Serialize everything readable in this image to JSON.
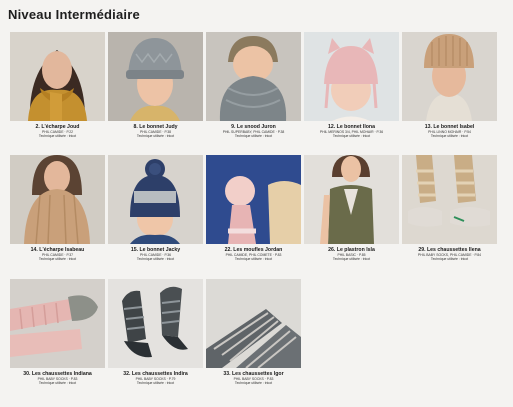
{
  "section": {
    "title": "Niveau Intermédiaire"
  },
  "items": [
    {
      "title": "2. L'écharpe Joud",
      "yarn": "PHIL CAMIDE · P.22",
      "technique": "Technique utilisée : tricot"
    },
    {
      "title": "8. Le bonnet Judy",
      "yarn": "PHIL CAMIDE · P.38",
      "technique": "Technique utilisée : tricot"
    },
    {
      "title": "9. Le snood Juron",
      "yarn": "PHIL SUPERBABY, PHIL CAMIDE · P.38",
      "technique": "Technique utilisée : tricot"
    },
    {
      "title": "12. Le bonnet Ilona",
      "yarn": "PHIL MERINOS 3/4, PHIL MOHAIR · P.36",
      "technique": "Technique utilisée : tricot"
    },
    {
      "title": "13. Le bonnet Isabel",
      "yarn": "PHIL LINNO MOHAIR · P.54",
      "technique": "Technique utilisée : tricot"
    },
    {
      "title": "14. L'écharpe Isabeau",
      "yarn": "PHIL CAMIDE · P.37",
      "technique": "Technique utilisée : tricot"
    },
    {
      "title": "15. Le bonnet Jacky",
      "yarn": "PHIL CAMIDE · P.36",
      "technique": "Technique utilisée : tricot"
    },
    {
      "title": "22. Les moufles Jordan",
      "yarn": "PHIL CAMIDE, PHIL COMETE · P.83",
      "technique": "Technique utilisée : tricot"
    },
    {
      "title": "26. Le plastron Isla",
      "yarn": "PHIL BASIC · P.85",
      "technique": "Technique utilisée : tricot"
    },
    {
      "title": "29. Les chaussettes Ilena",
      "yarn": "PHIL BABY SOCKS, PHIL CAMIDE · P.84",
      "technique": "Technique utilisée : tricot"
    },
    {
      "title": "30. Les chaussettes Indiana",
      "yarn": "PHIL BABY SOCKS · P.83",
      "technique": "Technique utilisée : tricot"
    },
    {
      "title": "32. Les chaussettes Indira",
      "yarn": "PHIL BABY SOCKS · P.79",
      "technique": "Technique utilisée : tricot"
    },
    {
      "title": "33. Les chaussettes Igor",
      "yarn": "PHIL BABY SOCKS · P.83",
      "technique": "Technique utilisée : tricot"
    }
  ],
  "colors": {
    "background": "#f4f3f1",
    "mustard": "#c4902f",
    "grey_knit": "#8e959a",
    "pink_knit": "#e8b7b8",
    "camel_knit": "#c9a07a",
    "navy_knit": "#2d3f69",
    "olive_knit": "#6a6b4a"
  },
  "icons": [
    "photo-scarf-mustard",
    "photo-hat-grey",
    "photo-snood-grey",
    "photo-hat-pink-ears",
    "photo-hat-camel",
    "photo-scarf-camel",
    "photo-hat-navy-pompom",
    "photo-mittens-pink",
    "photo-vest-olive",
    "photo-socks-beige",
    "photo-socks-pink",
    "photo-socks-grey-stripes",
    "photo-socks-grey-multi"
  ]
}
